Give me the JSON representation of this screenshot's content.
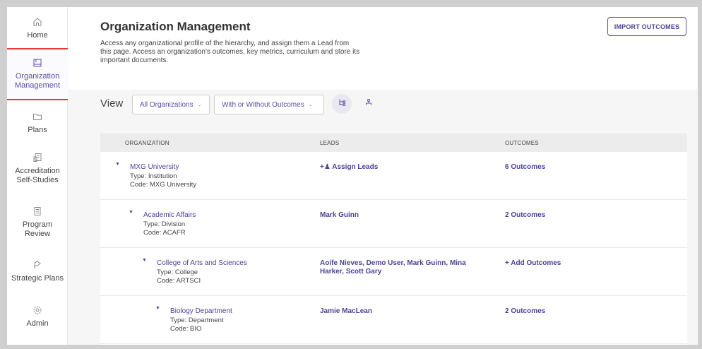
{
  "sidebar": {
    "items": [
      {
        "label": "Home",
        "icon": "home-icon"
      },
      {
        "label": "Organization Management",
        "icon": "org-management-icon",
        "active": true
      },
      {
        "label": "Plans",
        "icon": "folder-icon"
      },
      {
        "label": "Accreditation Self-Studies",
        "icon": "accreditation-icon"
      },
      {
        "label": "Program Review",
        "icon": "document-icon"
      },
      {
        "label": "Strategic Plans",
        "icon": "strategic-icon"
      },
      {
        "label": "Admin",
        "icon": "gear-icon"
      }
    ]
  },
  "header": {
    "title": "Organization Management",
    "description": "Access any organizational profile of the hierarchy, and assign them a Lead from this page. Access an organization's outcomes, key metrics, curriculum and store its important documents.",
    "import_button": "IMPORT OUTCOMES"
  },
  "filters": {
    "view_label": "View",
    "org_filter": "All Organizations",
    "outcome_filter": "With or Without Outcomes"
  },
  "table": {
    "headers": {
      "organization": "ORGANIZATION",
      "leads": "LEADS",
      "outcomes": "OUTCOMES"
    },
    "rows": [
      {
        "name": "MXG University",
        "type": "Type: Institution",
        "code": "Code: MXG University",
        "leads": "Assign Leads",
        "outcomes": "6 Outcomes",
        "level": 0
      },
      {
        "name": "Academic Affairs",
        "type": "Type: Division",
        "code": "Code: ACAFR",
        "leads": "Mark Guinn",
        "outcomes": "2 Outcomes",
        "level": 1
      },
      {
        "name": "College of Arts and Sciences",
        "type": "Type: College",
        "code": "Code: ARTSCI",
        "leads": "Aoife Nieves, Demo User, Mark Guinn, Mina Harker, Scott Gary",
        "outcomes": "+ Add Outcomes",
        "level": 2
      },
      {
        "name": "Biology Department",
        "type": "Type: Department",
        "code": "Code: BIO",
        "leads": "Jamie MacLean",
        "outcomes": "2 Outcomes",
        "level": 3
      }
    ]
  },
  "colors": {
    "accent": "#4c4396",
    "active_outline": "#e53a2f",
    "filter_bg": "#f6f6f6"
  }
}
